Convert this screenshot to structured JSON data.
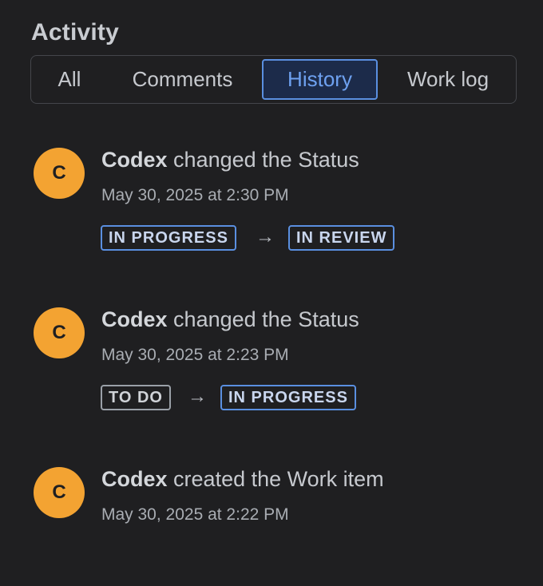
{
  "activity": {
    "title": "Activity",
    "tabs": [
      {
        "label": "All"
      },
      {
        "label": "Comments"
      },
      {
        "label": "History"
      },
      {
        "label": "Work log"
      }
    ],
    "active_tab": "History"
  },
  "entries": [
    {
      "avatar_initial": "C",
      "author": "Codex",
      "action": "changed the",
      "field": "Status",
      "timestamp": "May 30, 2025 at 2:30 PM",
      "from_status": "IN PROGRESS",
      "arrow": "→",
      "to_status": "IN REVIEW"
    },
    {
      "avatar_initial": "C",
      "author": "Codex",
      "action": "changed the",
      "field": "Status",
      "timestamp": "May 30, 2025 at 2:23 PM",
      "from_status": "TO DO",
      "arrow": "→",
      "to_status": "IN PROGRESS"
    },
    {
      "avatar_initial": "C",
      "author": "Codex",
      "action": "created the",
      "field": "Work item",
      "timestamp": "May 30, 2025 at 2:22 PM"
    }
  ],
  "colors": {
    "background": "#1f1f21",
    "avatar": "#f3a332",
    "accent": "#5a8fe0",
    "active_tab_bg": "#1c2b4a"
  }
}
